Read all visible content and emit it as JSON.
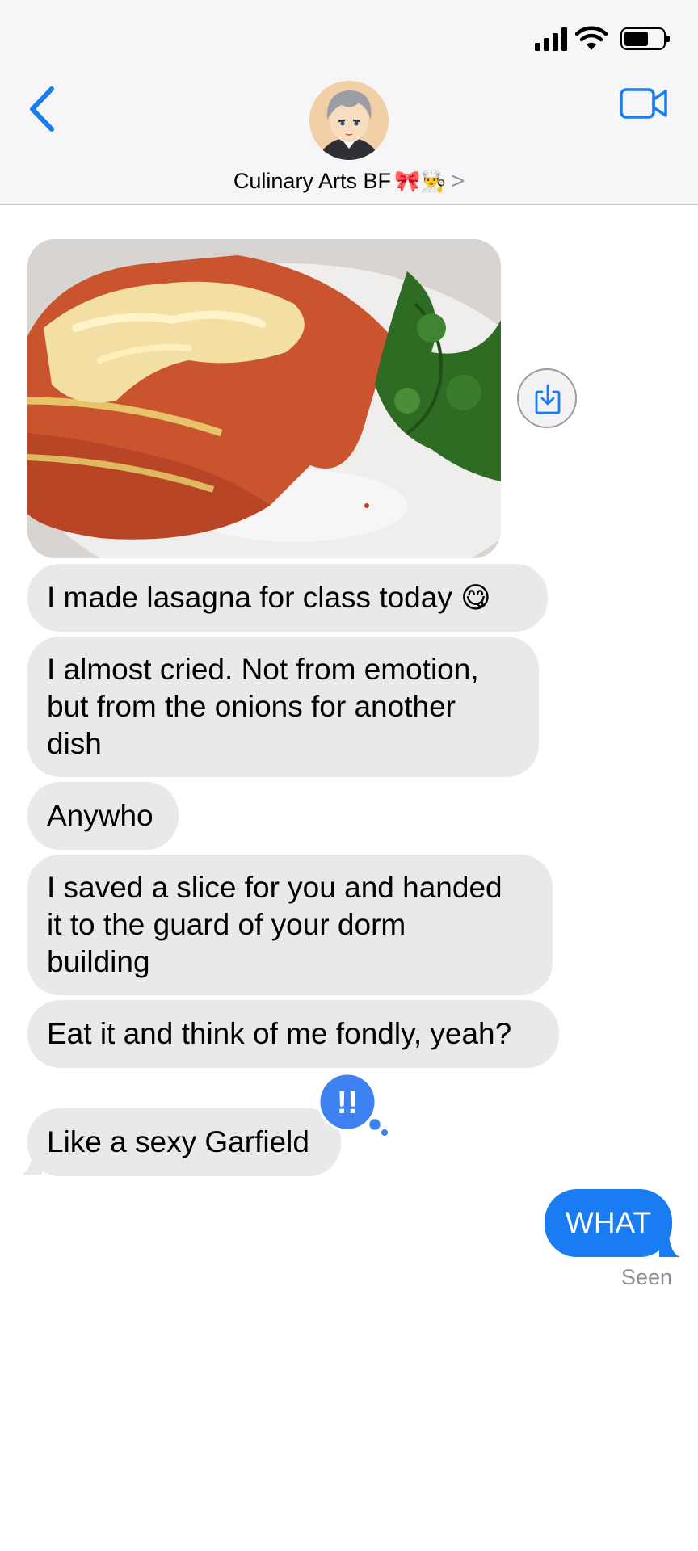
{
  "status_bar": {
    "icons": [
      "signal-bars-icon",
      "wifi-icon",
      "battery-icon"
    ],
    "battery_level": 0.65
  },
  "header": {
    "back_icon": "chevron-left-icon",
    "contact_name": "Culinary Arts BF",
    "contact_emojis": "🎀👨‍🍳",
    "chevron": ">",
    "video_icon": "video-camera-icon"
  },
  "thread": {
    "photo": "lasagna-photo",
    "save_icon": "download-icon",
    "incoming": [
      {
        "lines": [
          "I made lasagna for class today"
        ],
        "emoji": "😋"
      },
      {
        "lines": [
          "I almost cried. Not from emotion,",
          "but from the onions for another",
          "dish"
        ]
      },
      {
        "lines": [
          "Anywho"
        ]
      },
      {
        "lines": [
          "I saved a slice for you and handed",
          "it to the guard of your dorm",
          "building"
        ]
      },
      {
        "lines": [
          "Eat it and think of me fondly, yeah?"
        ]
      },
      {
        "lines": [
          "Like a sexy Garfield"
        ]
      }
    ],
    "tapback": {
      "symbol": "!!",
      "icon": "double-exclamation-icon"
    },
    "outgoing": {
      "text": "WHAT"
    },
    "receipt": "Seen"
  },
  "colors": {
    "accent": "#1a7cf3",
    "incoming_bubble": "#e9e9eb",
    "tapback": "#3d82f0"
  }
}
